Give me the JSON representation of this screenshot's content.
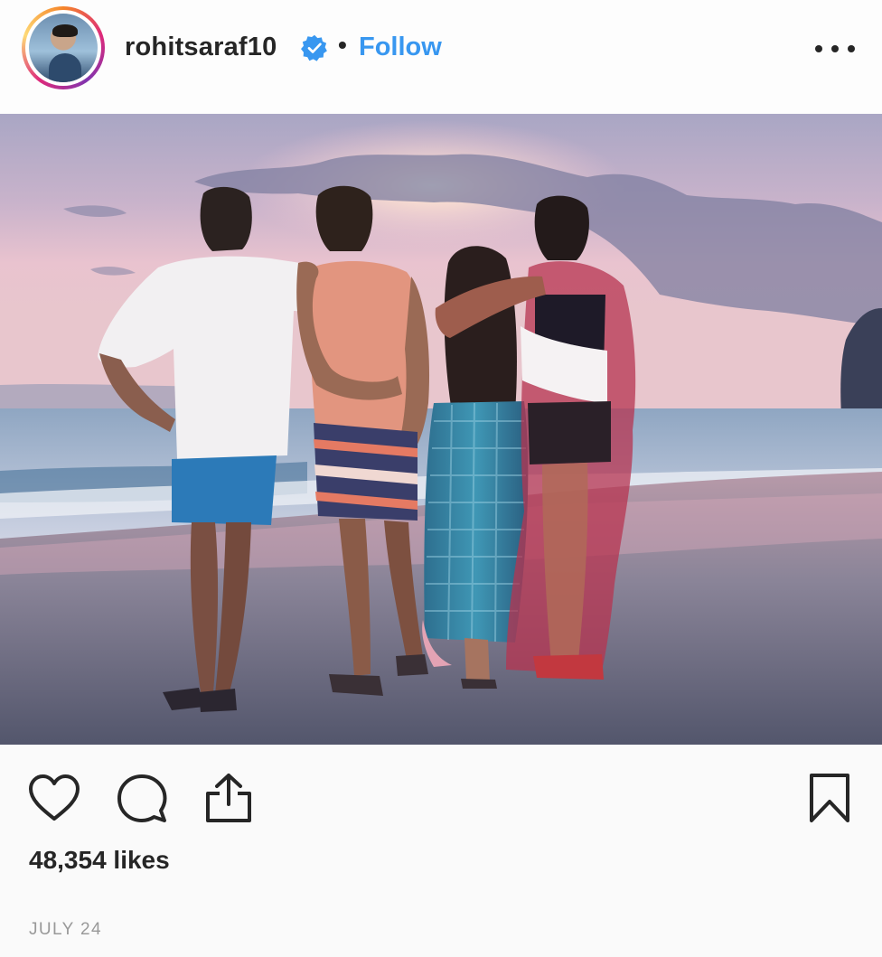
{
  "header": {
    "username": "rohitsaraf10",
    "separator": "•",
    "follow_label": "Follow",
    "verified_icon": "verified-badge-icon",
    "more_icon": "more-options-icon"
  },
  "photo": {
    "alt": "four friends from behind on a beach at sunset"
  },
  "actions": {
    "like_icon": "heart-icon",
    "comment_icon": "comment-icon",
    "share_icon": "share-icon",
    "save_icon": "bookmark-icon"
  },
  "post": {
    "likes_text": "48,354 likes",
    "date_text": "JULY 24"
  },
  "colors": {
    "link_blue": "#3897f0",
    "text_dark": "#262626",
    "text_muted": "#999999"
  }
}
